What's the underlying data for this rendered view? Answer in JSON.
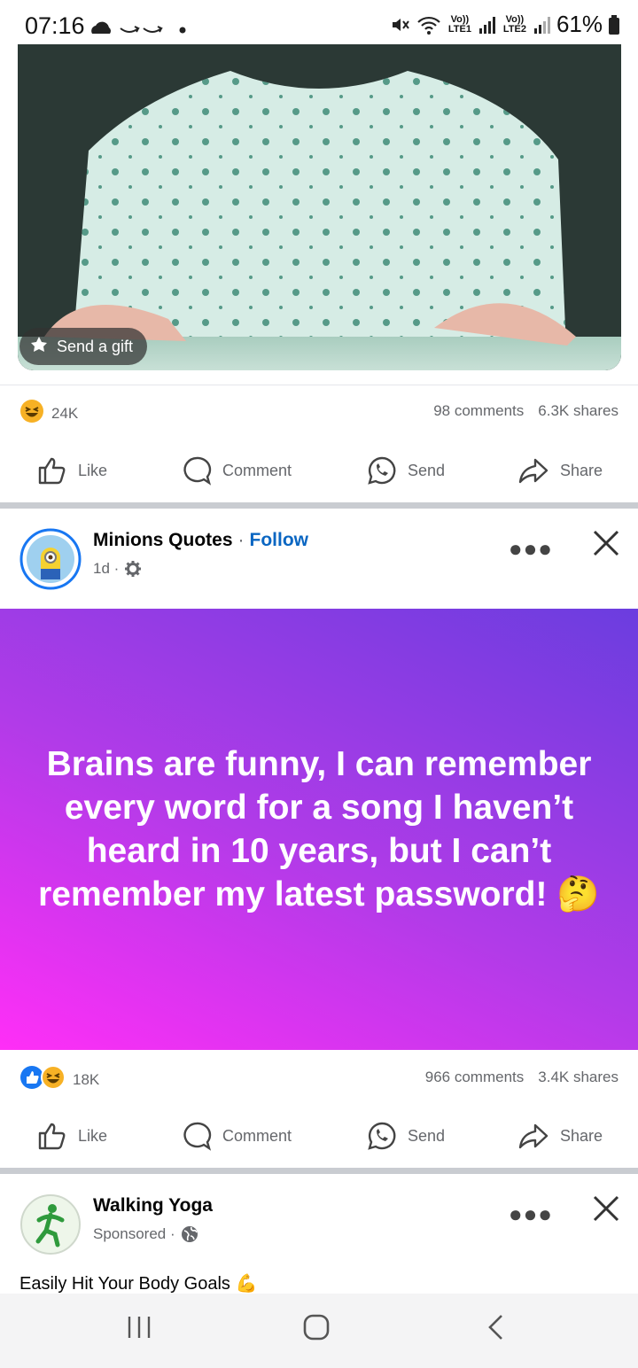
{
  "status_bar": {
    "time": "07:16",
    "network1": "Vo)) LTE1",
    "network2": "Vo)) LTE2",
    "battery": "61%"
  },
  "post1": {
    "gift_label": "Send a gift",
    "reaction_count": "24K",
    "comments": "98 comments",
    "shares": "6.3K shares"
  },
  "actions": {
    "like": "Like",
    "comment": "Comment",
    "send": "Send",
    "share": "Share"
  },
  "post2": {
    "page_name": "Minions Quotes",
    "separator": "·",
    "follow": "Follow",
    "time": "1d ·",
    "quote": "Brains are funny, I can remember every word for a song I haven’t heard in 10 years, but I can’t remember my latest password! 🤔",
    "reaction_count": "18K",
    "comments": "966 comments",
    "shares": "3.4K shares"
  },
  "post3": {
    "page_name": "Walking Yoga",
    "sponsored": "Sponsored ·",
    "headline": "Easily Hit Your Body Goals 💪"
  },
  "icons": {
    "more": "more-options-icon",
    "close": "close-icon"
  }
}
